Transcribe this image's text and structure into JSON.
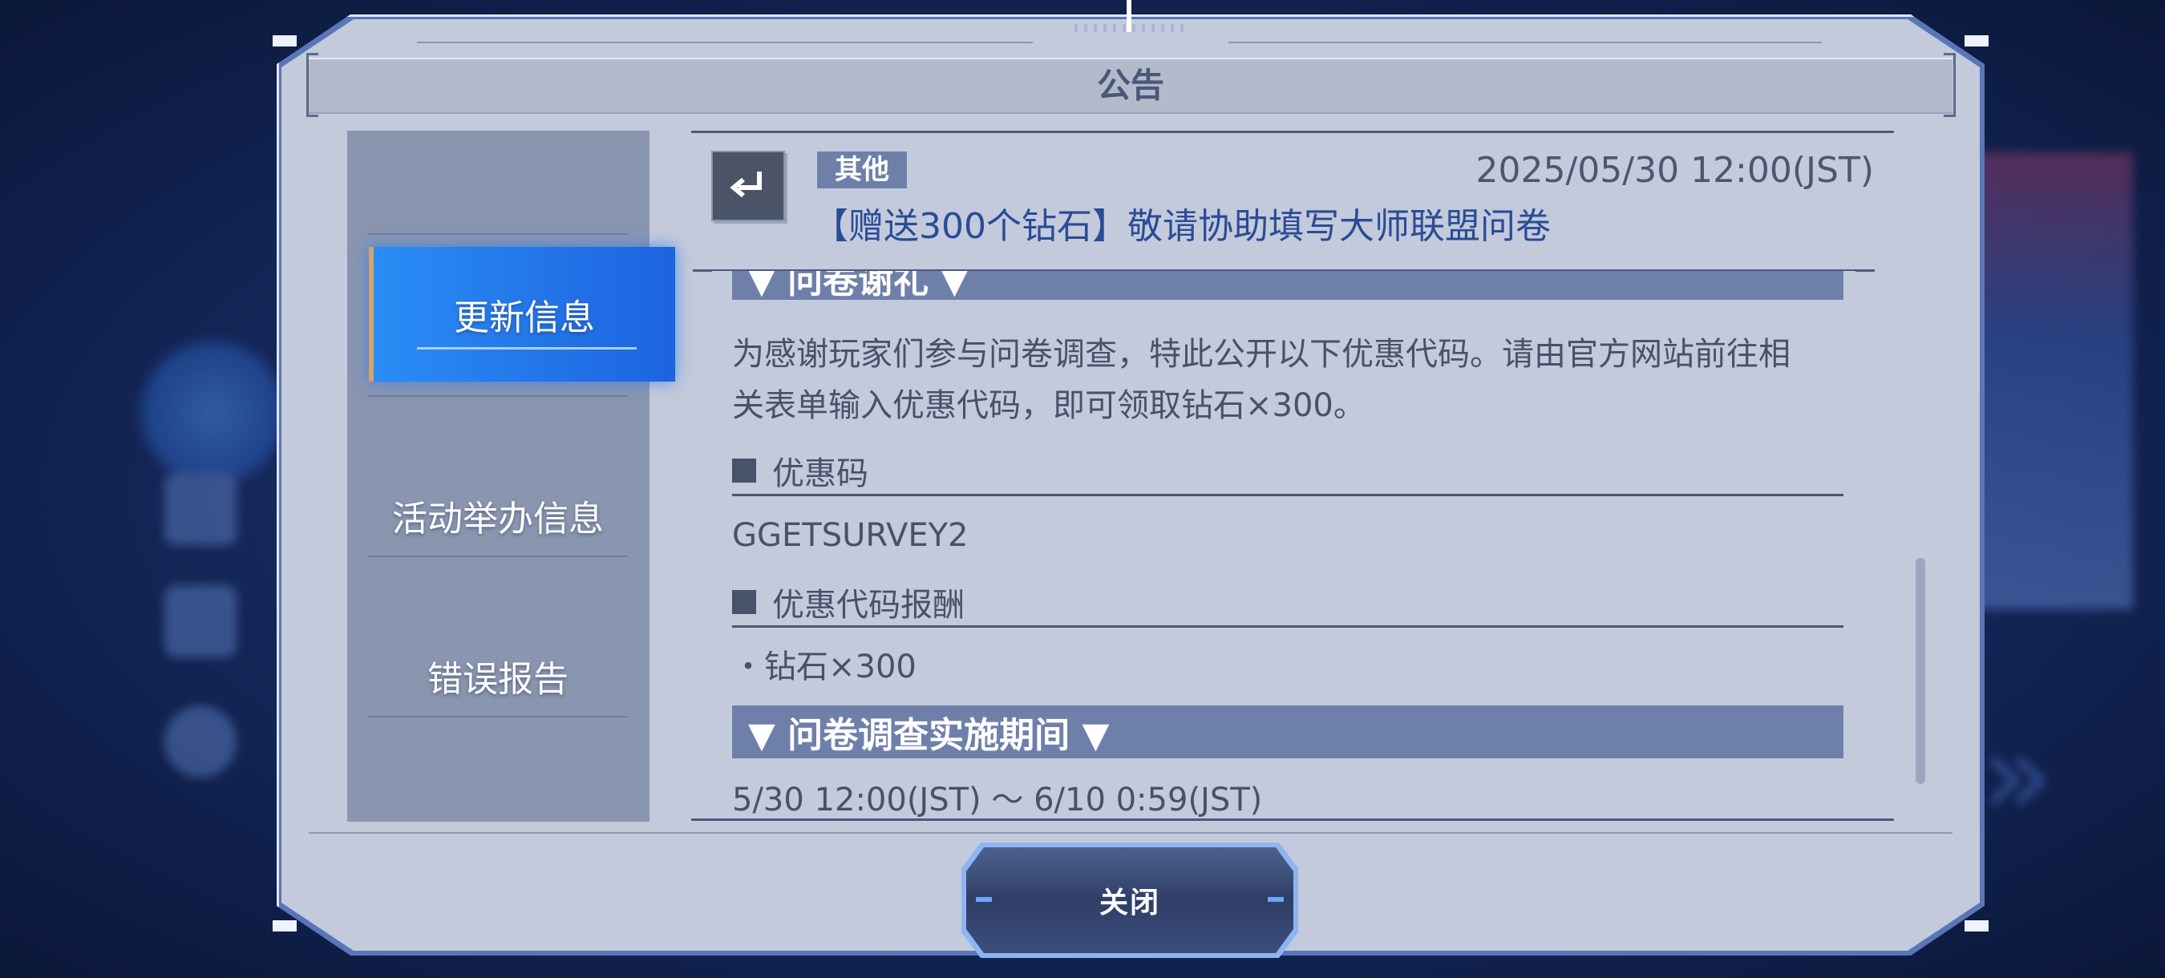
{
  "dialog": {
    "title": "公告"
  },
  "sidebar": {
    "items": [
      {
        "label": "更新信息",
        "active": true
      },
      {
        "label": "活动举办信息",
        "active": false
      },
      {
        "label": "错误报告",
        "active": false
      }
    ]
  },
  "notice": {
    "category": "其他",
    "date": "2025/05/30 12:00(JST)",
    "title": "【赠送300个钻石】敬请协助填写大师联盟问卷",
    "back_icon": "return-arrow-icon",
    "sections": {
      "thanks_heading": "▼ 问卷谢礼 ▼",
      "thanks_text_line1": "为感谢玩家们参与问卷调查，特此公开以下优惠代码。请由官方网站前往相",
      "thanks_text_line2": "关表单输入优惠代码，即可领取钻石×300。",
      "code_heading": "优惠码",
      "code_value": "GGETSURVEY2",
      "reward_heading": "优惠代码报酬",
      "reward_value": "・钻石×300",
      "period_heading": "▼ 问卷调查实施期间 ▼",
      "period_value": "5/30 12:00(JST) 〜 6/10 0:59(JST)"
    }
  },
  "footer": {
    "close_label": "关闭"
  },
  "colors": {
    "accent_blue": "#1d63e0",
    "section_bar": "#6e80aa",
    "title_blue": "#2a4c96"
  }
}
